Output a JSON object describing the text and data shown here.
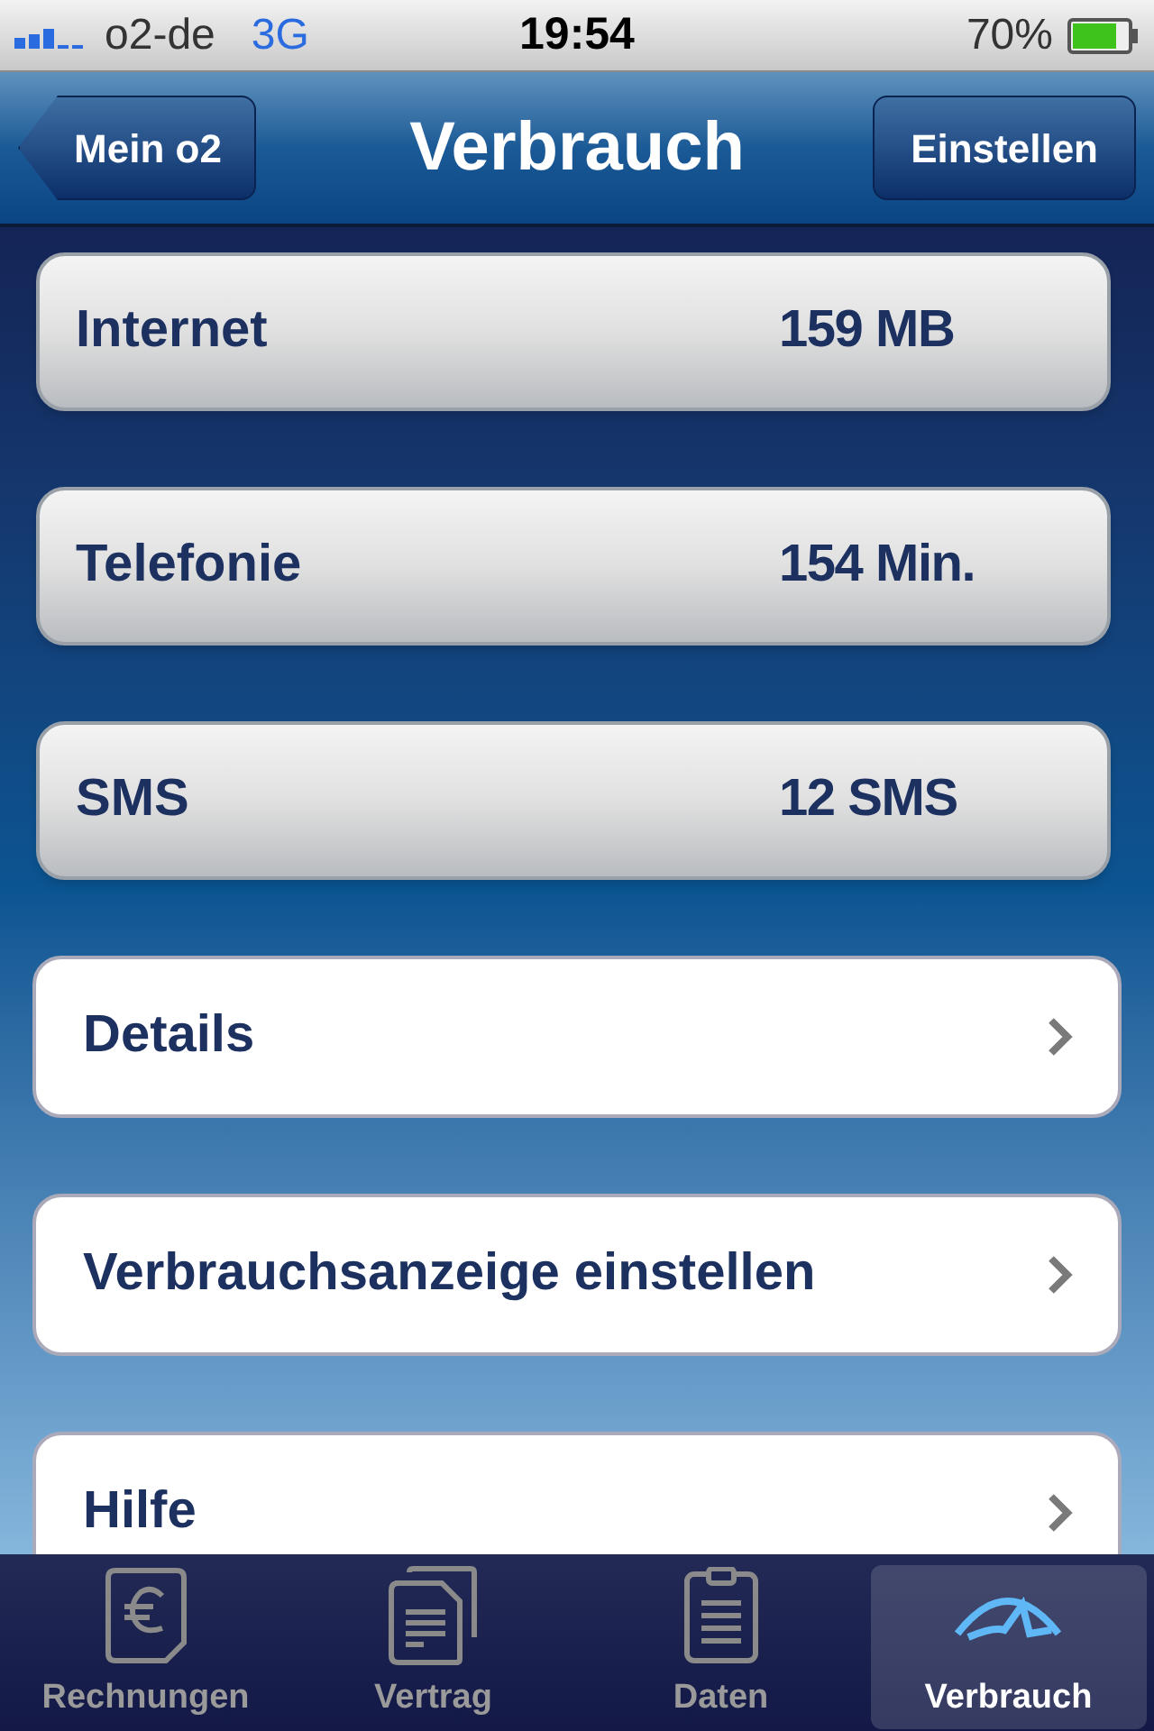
{
  "status_bar": {
    "carrier": "o2-de",
    "network": "3G",
    "time": "19:54",
    "battery": "70%"
  },
  "nav": {
    "back": "Mein o2",
    "title": "Verbrauch",
    "action": "Einstellen"
  },
  "usage": [
    {
      "label": "Internet",
      "value": "159 MB"
    },
    {
      "label": "Telefonie",
      "value": "154 Min."
    },
    {
      "label": "SMS",
      "value": "12 SMS"
    }
  ],
  "links": [
    {
      "label": "Details"
    },
    {
      "label": "Verbrauchsanzeige einstellen"
    },
    {
      "label": "Hilfe"
    }
  ],
  "tabs": [
    {
      "label": "Rechnungen",
      "kind": "bill",
      "selected": false
    },
    {
      "label": "Vertrag",
      "kind": "contract",
      "selected": false
    },
    {
      "label": "Daten",
      "kind": "data",
      "selected": false
    },
    {
      "label": "Verbrauch",
      "kind": "gauge",
      "selected": true
    }
  ]
}
